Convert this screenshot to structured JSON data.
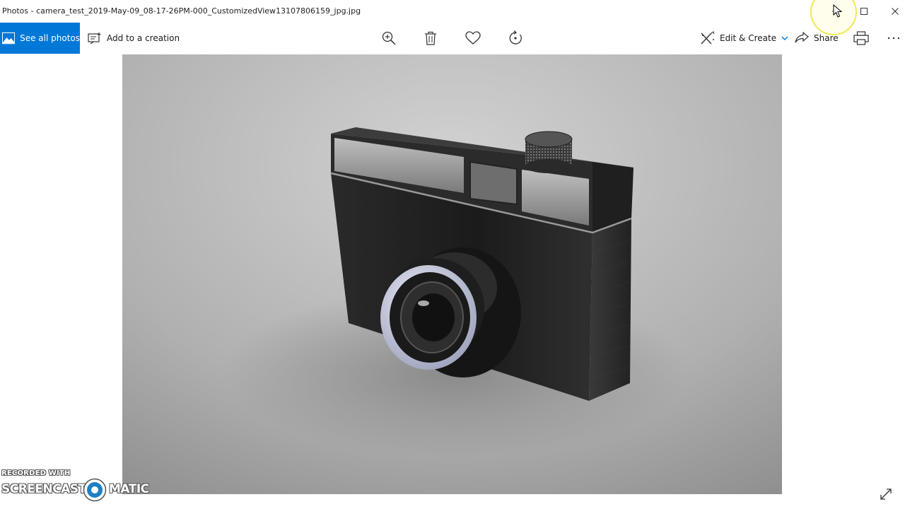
{
  "window": {
    "title": "Photos - camera_test_2019-May-09_08-17-26PM-000_CustomizedView13107806159_jpg.jpg",
    "controls": [
      "minimize-icon",
      "maximize-icon",
      "close-icon"
    ]
  },
  "toolbar": {
    "see_all_photos": "See all photos",
    "add_to_creation": "Add to a creation",
    "edit_create": "Edit & Create",
    "share": "Share",
    "icons": [
      "zoom-in-icon",
      "delete-icon",
      "favorite-icon",
      "rotate-icon",
      "print-icon",
      "more-icon"
    ]
  },
  "watermark": {
    "top": "RECORDED WITH",
    "left": "SCREENCAST",
    "right": "MATIC"
  },
  "colors": {
    "accent": "#0078d7",
    "cursor_highlight": "#f2e85a"
  }
}
